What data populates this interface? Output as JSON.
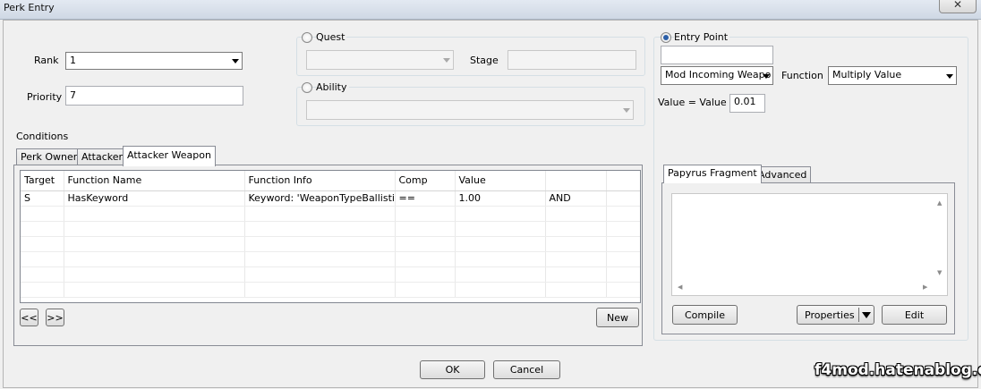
{
  "window": {
    "title": "Perk Entry",
    "close_glyph": "✕"
  },
  "rank": {
    "label": "Rank",
    "value": "1"
  },
  "priority": {
    "label": "Priority",
    "value": "7"
  },
  "quest": {
    "radio_label": "Quest",
    "stage_label": "Stage",
    "value": "",
    "stage_value": ""
  },
  "ability": {
    "radio_label": "Ability",
    "value": ""
  },
  "entry_point": {
    "radio_label": "Entry Point",
    "text_value": "",
    "selected": "Mod Incoming Weapo",
    "function_label": "Function",
    "function_value": "Multiply Value",
    "formula_label": "Value = Value *",
    "value": "0.01"
  },
  "conditions": {
    "label": "Conditions",
    "tabs": [
      "Perk Owner",
      "Attacker",
      "Attacker Weapon"
    ],
    "active_tab": "Attacker Weapon",
    "columns": [
      "Target",
      "Function Name",
      "Function Info",
      "Comp",
      "Value",
      "",
      ""
    ],
    "rows": [
      [
        "S",
        "HasKeyword",
        "Keyword: 'WeaponTypeBallistic'",
        "==",
        "1.00",
        "AND",
        ""
      ]
    ],
    "prev_button": "<<",
    "next_button": ">>",
    "new_button": "New"
  },
  "fragment": {
    "tabs": [
      "Papyrus Fragment",
      "Advanced"
    ],
    "active_tab": "Papyrus Fragment",
    "compile_button": "Compile",
    "properties_button": "Properties",
    "edit_button": "Edit"
  },
  "dialog": {
    "ok_button": "OK",
    "cancel_button": "Cancel"
  },
  "watermark": "f4mod.hatenablog.com",
  "colors": {
    "radio_selected": "#2b5fa8",
    "border": "#abadb3",
    "dialog_bg": "#f0f0f0"
  }
}
